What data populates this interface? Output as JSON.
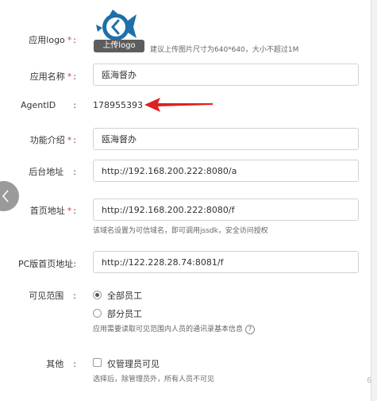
{
  "form": {
    "logo": {
      "label": "应用logo",
      "required": "*",
      "upload_button": "上传logo",
      "hint": "建议上传图片尺寸为640*640，大小不超过1M"
    },
    "app_name": {
      "label": "应用名称",
      "required": "*",
      "value": "瓯海督办"
    },
    "agent_id": {
      "label": "AgentID",
      "value": "178955393"
    },
    "intro": {
      "label": "功能介绍",
      "required": "*",
      "value": "瓯海督办"
    },
    "backend_url": {
      "label": "后台地址",
      "value": "http://192.168.200.222:8080/a"
    },
    "home_url": {
      "label": "首页地址",
      "required": "*",
      "value": "http://192.168.200.222:8080/f",
      "hint": "该域名设置为可信域名，即可调用jssdk，安全访问授权"
    },
    "pc_home_url": {
      "label": "PC版首页地址:",
      "value": "http://122.228.28.74:8081/f"
    },
    "visibility": {
      "label": "可见范围",
      "options": [
        {
          "label": "全部员工",
          "selected": true
        },
        {
          "label": "部分员工",
          "selected": false
        }
      ],
      "hint": "应用需要读取可见范围内人员的通讯录基本信息"
    },
    "other": {
      "label": "其他",
      "checkbox_label": "仅管理员可见",
      "checked": false,
      "hint": "选择后，除管理员外，所有人员不可见"
    }
  },
  "colon": ":",
  "page_edge_number": "6",
  "colors": {
    "required": "#e4393c",
    "arrow": "#e02020",
    "logo_blue": "#1f6fa8",
    "back_button": "#9a9a9a"
  },
  "icons": {
    "back": "chevron-left-icon",
    "help": "question-circle-icon",
    "logo": "fish-logo-icon"
  }
}
